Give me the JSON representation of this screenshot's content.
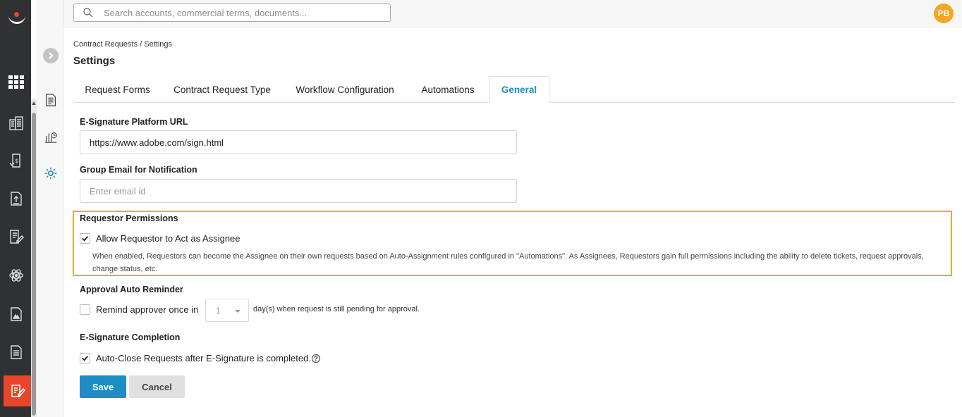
{
  "search": {
    "placeholder": "Search accounts, commercial terms, documents..."
  },
  "user": {
    "initials": "PB",
    "avatar_color": "#f5a623"
  },
  "breadcrumb": "Contract Requests / Settings",
  "page_title": "Settings",
  "tabs": [
    {
      "label": "Request Forms"
    },
    {
      "label": "Contract Request Type"
    },
    {
      "label": "Workflow Configuration"
    },
    {
      "label": "Automations"
    },
    {
      "label": "General",
      "active": true
    }
  ],
  "esign_url": {
    "label": "E-Signature Platform URL",
    "value": "https://www.adobe.com/sign.html"
  },
  "group_email": {
    "label": "Group Email for Notification",
    "placeholder": "Enter email id"
  },
  "requestor_permissions": {
    "label": "Requestor Permissions",
    "checkbox_label": "Allow Requestor to Act as Assignee",
    "checked": true,
    "help": "When enabled, Requestors can become the Assignee on their own requests based on Auto-Assignment rules configured in \"Automations\". As Assignees, Requestors gain full permissions including the ability to delete tickets, request approvals, change status, etc."
  },
  "approval_reminder": {
    "label": "Approval Auto Reminder",
    "checkbox_label": "Remind approver once in",
    "checked": false,
    "days_value": "1",
    "suffix": "day(s) when request is still pending for approval."
  },
  "esign_completion": {
    "label": "E-Signature Completion",
    "checkbox_label": "Auto-Close Requests after E-Signature is completed.",
    "checked": true,
    "help_glyph": "?"
  },
  "buttons": {
    "save": "Save",
    "cancel": "Cancel"
  },
  "colors": {
    "accent": "#1d8dc3",
    "brand": "#e9452b",
    "highlight": "#f2a91e",
    "rail": "#2f3133"
  },
  "icons": {
    "rail": [
      "logo-icon",
      "grid-icon",
      "buildings-icon",
      "dollar-document-icon",
      "upload-document-icon",
      "edit-document-icon",
      "atom-icon",
      "image-document-icon",
      "list-document-icon",
      "contract-edit-icon"
    ],
    "sub": [
      "chevron-right-icon",
      "document-icon",
      "report-chart-icon",
      "settings-gear-icon"
    ]
  }
}
